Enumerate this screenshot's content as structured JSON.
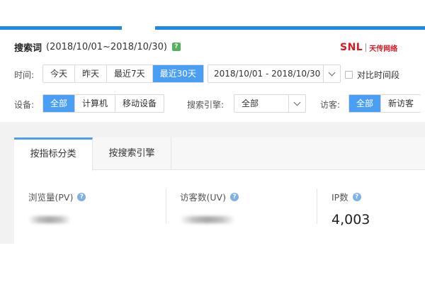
{
  "header": {
    "title": "搜索词",
    "range": "(2018/10/01~2018/10/30)",
    "help_glyph": "?",
    "brand_logo": "SNL",
    "brand_name": "天传网络"
  },
  "time_filter": {
    "label": "时间:",
    "options": [
      "今天",
      "昨天",
      "最近7天",
      "最近30天"
    ],
    "selected": "最近30天",
    "date_range": "2018/10/01 - 2018/10/30",
    "compare_label": "对比时间段"
  },
  "device_filter": {
    "label": "设备:",
    "options": [
      "全部",
      "计算机",
      "移动设备"
    ],
    "selected": "全部"
  },
  "engine_filter": {
    "label": "搜索引擎:",
    "value": "全部"
  },
  "visitor_filter": {
    "label": "访客:",
    "options": [
      "全部",
      "新访客"
    ],
    "selected": "全部"
  },
  "tabs": [
    {
      "label": "按指标分类",
      "active": true
    },
    {
      "label": "按搜索引擎",
      "active": false
    }
  ],
  "metrics": [
    {
      "label": "浏览量(PV)",
      "value": "",
      "obscured": true
    },
    {
      "label": "访客数(UV)",
      "value": "",
      "obscured": true
    },
    {
      "label": "IP数",
      "value": "4,003",
      "obscured": false
    }
  ],
  "colors": {
    "accent": "#4a9ff5",
    "topbar": "#1e88e5",
    "brand": "#d71920",
    "help_green": "#52b35c"
  },
  "icons": {
    "help": "question-icon",
    "dropdown": "chevron-down-icon"
  }
}
